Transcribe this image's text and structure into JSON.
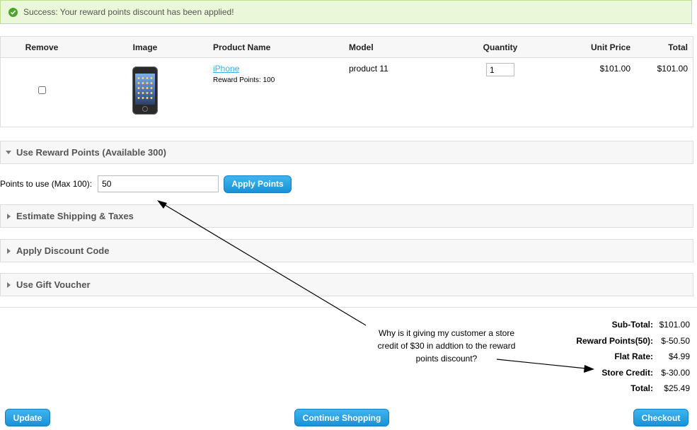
{
  "alert": {
    "message": "Success: Your reward points discount has been applied!"
  },
  "cart": {
    "headers": [
      "Remove",
      "Image",
      "Product Name",
      "Model",
      "Quantity",
      "Unit Price",
      "Total"
    ],
    "items": [
      {
        "name": "iPhone",
        "reward_points": "Reward Points: 100",
        "model": "product 11",
        "quantity": "1",
        "unit_price": "$101.00",
        "total": "$101.00"
      }
    ]
  },
  "sections": {
    "reward": "Use Reward Points (Available 300)",
    "shipping": "Estimate Shipping & Taxes",
    "discount": "Apply Discount Code",
    "voucher": "Use Gift Voucher"
  },
  "points_form": {
    "label": "Points to use (Max 100):",
    "value": "50",
    "button": "Apply Points"
  },
  "totals": [
    {
      "label": "Sub-Total:",
      "value": "$101.00"
    },
    {
      "label": "Reward Points(50):",
      "value": "$-50.50"
    },
    {
      "label": "Flat Rate:",
      "value": "$4.99"
    },
    {
      "label": "Store Credit:",
      "value": "$-30.00"
    },
    {
      "label": "Total:",
      "value": "$25.49"
    }
  ],
  "annotation": {
    "line1": "Why is it giving my customer a store",
    "line2": "credit of $30 in addtion to the reward",
    "line3": "points discount?"
  },
  "buttons": {
    "update": "Update",
    "continue": "Continue Shopping",
    "checkout": "Checkout"
  },
  "colors": {
    "accent": "#1a91d6",
    "success_bg": "#eaf7d9",
    "link": "#38b0e3"
  }
}
